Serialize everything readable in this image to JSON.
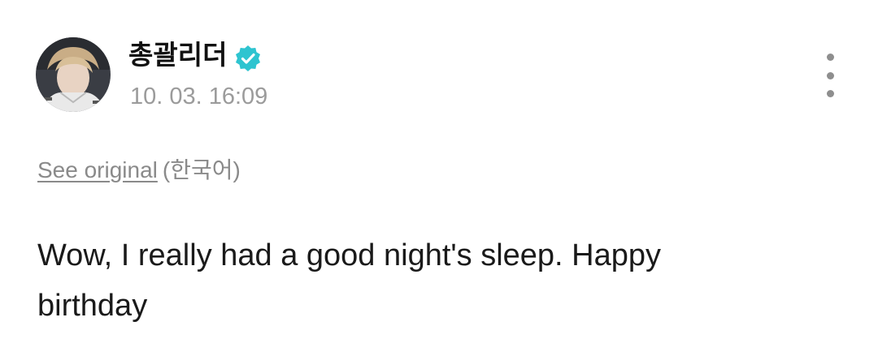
{
  "author": {
    "name": "총괄리더",
    "verified_icon": "verified-badge-icon",
    "verified_color": "#2ec4d0"
  },
  "timestamp": "10. 03. 16:09",
  "menu_icon": "more-vertical-icon",
  "translation": {
    "see_original_label": "See original",
    "language_label": "(한국어)"
  },
  "post": {
    "text": "Wow, I really had a good night's sleep. Happy birthday"
  }
}
